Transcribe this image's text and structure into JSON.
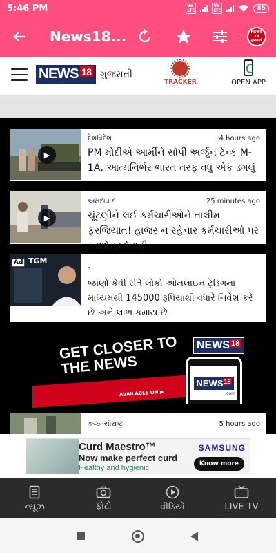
{
  "status_bar": {
    "time": "5:46 PM",
    "battery": "85",
    "network_tag": "Vo LTE"
  },
  "app_bar": {
    "title": "News18...",
    "icons": [
      "back-arrow-icon",
      "refresh-icon",
      "star-icon",
      "settings-sliders-icon",
      "news18-gujarati-logo"
    ],
    "logo_text": "NEWS 18 ગુજરાતી",
    "colors": {
      "background": "#ff4f7f",
      "text": "#ffffff"
    }
  },
  "brand_bar": {
    "logo_text": "NEWS",
    "logo_number": "18",
    "language_label": "ગુજરાતી",
    "tracker_label": "TRACKER",
    "open_app_label": "OPEN APP"
  },
  "feed": [
    {
      "category": "દેશવિદેશ",
      "time": "4 hours ago",
      "headline": "PM મોદીએ આર્મીને સોંપી અર્જુન ટેન્ક M-1A, આત્મનિર્ભર ભારત તરફ વધુ એક ડગલું"
    },
    {
      "category": "અમદાવાદ",
      "time": "25 minutes ago",
      "headline": "ચૂંટણીને લઈ કર્મચારીઓને તાલીમ ફરજિયાત! હાજર ન રહેનાર કર્મચારીઓ પર કરાશે કાર્યવાહી"
    },
    {
      "category": "કચ્છ-સૌરાષ્ટ્ર",
      "time": "5 hours ago",
      "headline": ""
    }
  ],
  "sponsored": {
    "ad_label": "Ad",
    "advertiser": "TGM",
    "title": ".",
    "text": "જાણો કેવી રીતે લોકો ઓનલાઇન ટ્રેડિંગના માધ્યમથી 145000 રૂપિયાથી વધારે નિવેશ કરે છે અને લાભ કમાય છે"
  },
  "promo_banner": {
    "headline": "GET CLOSER TO THE NEWS",
    "availability": "AVAILABLE ON",
    "brand": "NEWS",
    "brand_number": "18",
    "domain": ".com"
  },
  "ad_banner": {
    "product": "Curd Maestro™",
    "tagline": "Now make perfect curd",
    "sub": "Healthy and hygienic",
    "brand": "SAMSUNG",
    "cta": "Know more"
  },
  "bottom_nav": {
    "tabs": [
      {
        "label": "ન્યૂઝ",
        "icon": "document-icon"
      },
      {
        "label": "ફોટો",
        "icon": "camera-icon"
      },
      {
        "label": "વીડિયો",
        "icon": "play-circle-icon"
      },
      {
        "label": "LIVE TV",
        "icon": "tv-icon"
      }
    ]
  }
}
